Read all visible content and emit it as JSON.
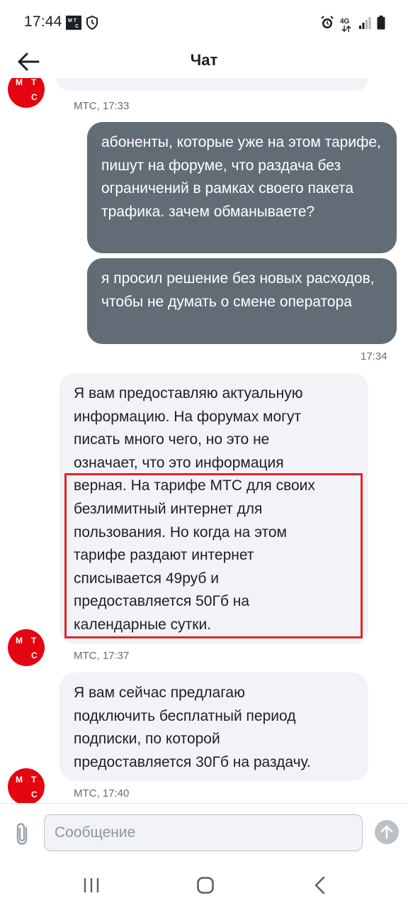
{
  "status_bar": {
    "time": "17:44",
    "icons_left": [
      "carrier-logo-icon",
      "shield-icon"
    ],
    "icons_right": [
      "alarm-icon",
      "network-4g-icon",
      "signal-icon",
      "battery-icon"
    ],
    "network_label": "4G"
  },
  "header": {
    "title": "Чат",
    "back_icon": "arrow-left-icon"
  },
  "avatar": {
    "letters": [
      "М",
      "Т",
      "С"
    ],
    "color": "#e30611"
  },
  "messages": [
    {
      "sender": "МТС",
      "meta": "МТС, 17:33"
    },
    {
      "direction": "out",
      "text": "абоненты, которые уже на этом тарифе, пишут на форуме, что раздача без ограничений в рамках своего пакета трафика. зачем обманываете?"
    },
    {
      "direction": "out",
      "text": "я просил решение без новых расходов, чтобы не думать о смене оператора"
    },
    {
      "time": "17:34"
    },
    {
      "direction": "in",
      "lines": [
        "Я вам предоставляю актуальную",
        "информацию. На форумах могут",
        "писать много чего, но это не",
        "означает, что это информация",
        "верная. На тарифе МТС для своих",
        "безлимитный интернет для",
        "пользования. Но когда на этом",
        "тарифе раздают интернет",
        "списывается 49руб и",
        "предоставляется 50Гб на",
        "календарные сутки."
      ],
      "meta": "МТС, 17:37"
    },
    {
      "direction": "in",
      "lines": [
        "Я вам сейчас предлагаю",
        "подключить бесплатный период",
        "подписки, по которой",
        "предоставляется 30Гб на раздачу."
      ],
      "meta": "МТС, 17:40"
    }
  ],
  "composer": {
    "placeholder": "Сообщение",
    "attach_icon": "paperclip-icon",
    "send_icon": "arrow-up-icon"
  },
  "nav": {
    "icons": [
      "recent-apps-icon",
      "home-icon",
      "back-icon"
    ]
  },
  "colors": {
    "brand": "#e30611",
    "outgoing_bubble": "#626c77",
    "incoming_bubble": "#f2f3f7",
    "highlight": "#e3242b"
  }
}
